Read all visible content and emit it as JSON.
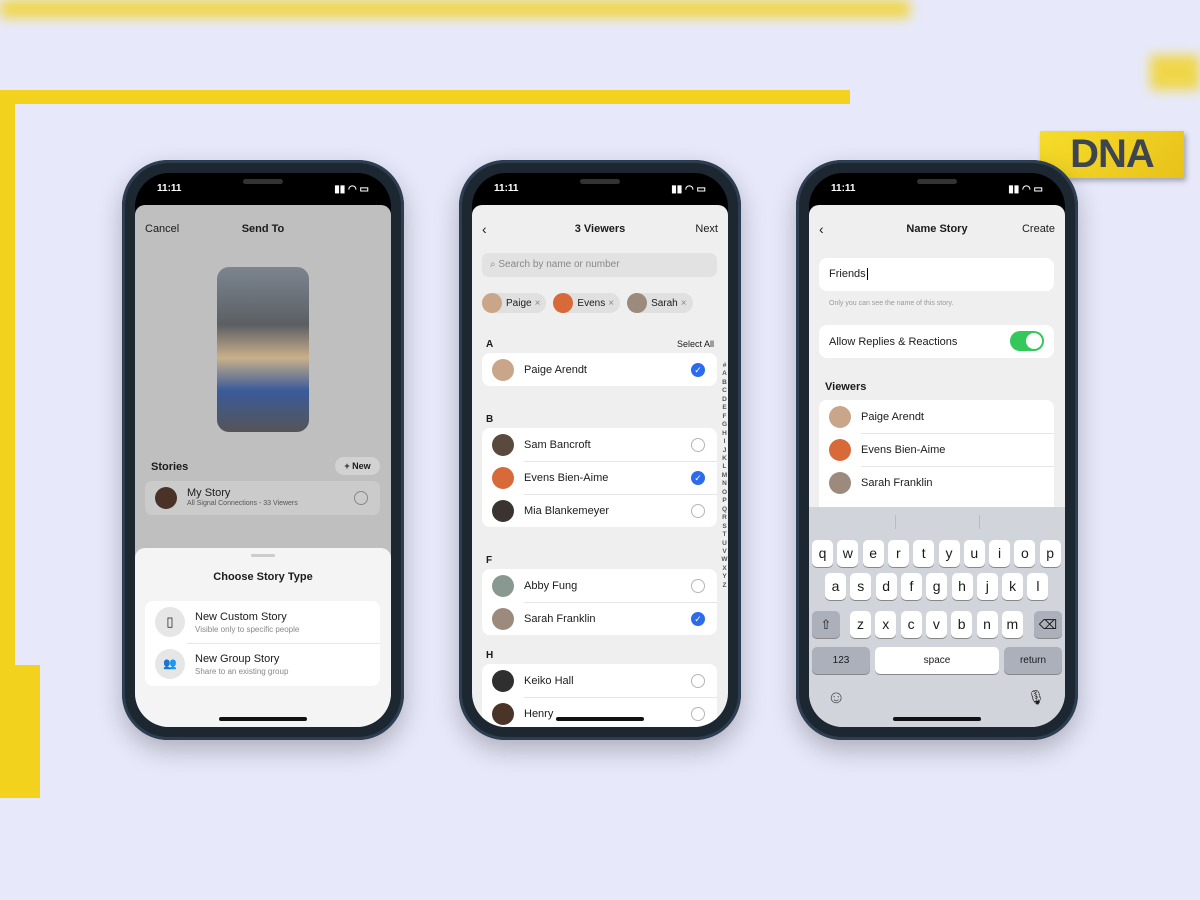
{
  "brand": {
    "logo_text": "DNA",
    "yellow": "#f2d21c"
  },
  "status_time": "11:11",
  "screen1": {
    "cancel": "Cancel",
    "title": "Send To",
    "stories_label": "Stories",
    "new_button": "+ New",
    "my_story": {
      "name": "My Story",
      "subtitle": "All Signal Connections - 33 Viewers"
    },
    "sheet_title": "Choose Story Type",
    "options": [
      {
        "title": "New Custom Story",
        "subtitle": "Visible only to specific people",
        "icon": "phone-stack-icon"
      },
      {
        "title": "New Group Story",
        "subtitle": "Share to an existing group",
        "icon": "group-icon"
      }
    ]
  },
  "screen2": {
    "title": "3 Viewers",
    "next": "Next",
    "search_placeholder": "Search by name or number",
    "chips": [
      {
        "name": "Paige",
        "color": "#c9a58a"
      },
      {
        "name": "Evens",
        "color": "#d86a3a"
      },
      {
        "name": "Sarah",
        "color": "#9c8a7c"
      }
    ],
    "select_all": "Select All",
    "sections": [
      {
        "letter": "A",
        "contacts": [
          {
            "name": "Paige Arendt",
            "checked": true,
            "color": "#c9a58a"
          }
        ]
      },
      {
        "letter": "B",
        "contacts": [
          {
            "name": "Sam Bancroft",
            "checked": false,
            "color": "#5a4a3e"
          },
          {
            "name": "Evens Bien-Aime",
            "checked": true,
            "color": "#d86a3a"
          },
          {
            "name": "Mia Blankemeyer",
            "checked": false,
            "color": "#3b3330"
          }
        ]
      },
      {
        "letter": "F",
        "contacts": [
          {
            "name": "Abby Fung",
            "checked": false,
            "color": "#8a9990"
          },
          {
            "name": "Sarah Franklin",
            "checked": true,
            "color": "#9c8a7c"
          }
        ]
      },
      {
        "letter": "H",
        "contacts": [
          {
            "name": "Keiko Hall",
            "checked": false,
            "color": "#2f2f2f"
          },
          {
            "name": "Henry",
            "checked": false,
            "color": "#4a3428"
          }
        ]
      }
    ],
    "index": [
      "#",
      "A",
      "B",
      "C",
      "D",
      "E",
      "F",
      "G",
      "H",
      "I",
      "J",
      "K",
      "L",
      "M",
      "N",
      "O",
      "P",
      "Q",
      "R",
      "S",
      "T",
      "U",
      "V",
      "W",
      "X",
      "Y",
      "Z"
    ]
  },
  "screen3": {
    "title": "Name Story",
    "create": "Create",
    "name_value": "Friends",
    "hint": "Only you can see the name of this story.",
    "toggle_label": "Allow Replies & Reactions",
    "toggle_on": true,
    "toggle_color": "#34c759",
    "viewers_label": "Viewers",
    "viewers": [
      {
        "name": "Paige Arendt",
        "color": "#c9a58a"
      },
      {
        "name": "Evens Bien-Aime",
        "color": "#d86a3a"
      },
      {
        "name": "Sarah Franklin",
        "color": "#9c8a7c"
      }
    ],
    "keyboard": {
      "row1": [
        "q",
        "w",
        "e",
        "r",
        "t",
        "y",
        "u",
        "i",
        "o",
        "p"
      ],
      "row2": [
        "a",
        "s",
        "d",
        "f",
        "g",
        "h",
        "j",
        "k",
        "l"
      ],
      "row3": [
        "z",
        "x",
        "c",
        "v",
        "b",
        "n",
        "m"
      ],
      "numbers": "123",
      "space": "space",
      "return": "return"
    }
  }
}
